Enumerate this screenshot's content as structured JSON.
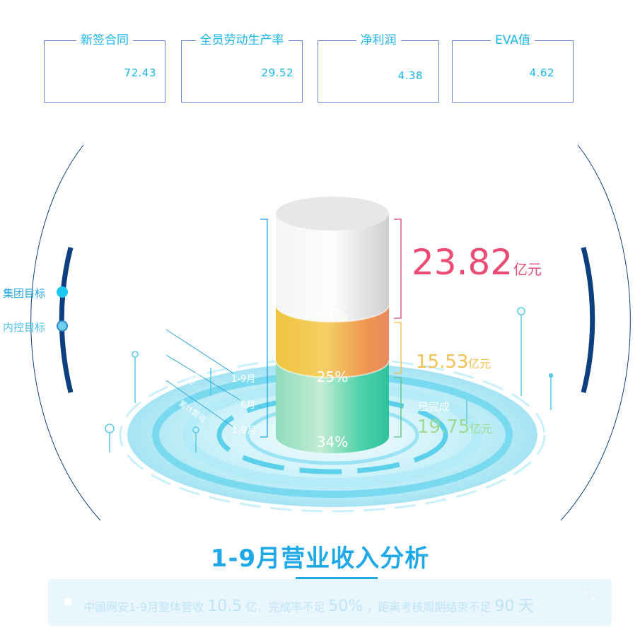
{
  "kpis": [
    {
      "label": "新签合同",
      "value": "72.43"
    },
    {
      "label": "全员劳动生产率",
      "value": "29.52"
    },
    {
      "label": "净利润",
      "value": "4.38"
    },
    {
      "label": "EVA值",
      "value": "4.62"
    }
  ],
  "legend": {
    "group_target": "集团目标",
    "internal_target": "内控目标"
  },
  "chart_data": {
    "type": "stacked-cylinder",
    "title": "1-9月营业收入分析",
    "segments": [
      {
        "percent": "34%",
        "value": 34,
        "color": "#3dcfa6"
      },
      {
        "percent": "25%",
        "value": 25,
        "color": "#f2b341"
      },
      {
        "percent": "41%",
        "value": 41,
        "color": "#e4e4e4"
      }
    ],
    "callouts": [
      {
        "value": "23.82",
        "unit": "亿元",
        "color": "#ec4c73"
      },
      {
        "value": "15.53",
        "unit": "亿元",
        "color": "#f3c04f"
      },
      {
        "value": "19.75",
        "unit": "亿元",
        "color": "#9edb92",
        "prefix": "已完成"
      }
    ],
    "side_labels": [
      "1-9月",
      "6月",
      "1-9月"
    ],
    "diagonal_labels": [
      "营收",
      "累计营收"
    ]
  },
  "marquee": {
    "prefix": "中国网安1-9月整体营收",
    "num1": "10.5",
    "mid1": "亿，完成率不足",
    "num2": "50%",
    "mid2": "，距离考核周期结束不足",
    "num3": "90",
    "suffix": "天",
    "scroll_icon": "⌃⌄"
  },
  "colors": {
    "accent": "#1fa9e9",
    "kpi_border": "#6a7fd6",
    "arc_dark": "#0d3f7f",
    "ring": "#5fd2ec"
  }
}
